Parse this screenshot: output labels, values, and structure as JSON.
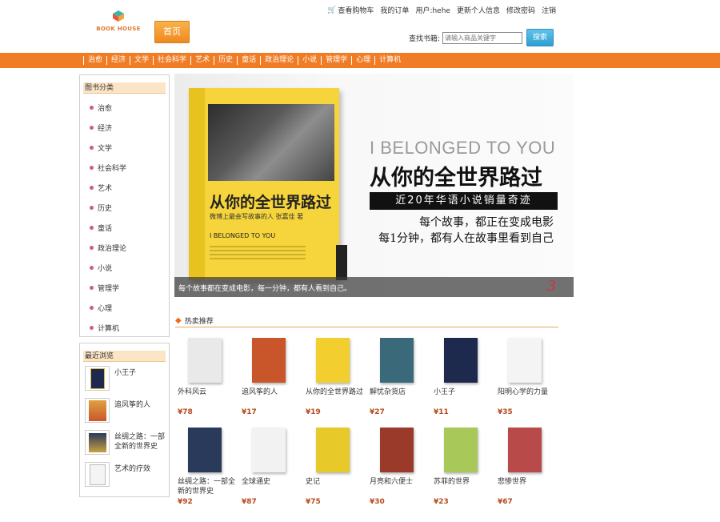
{
  "header": {
    "logo_text": "BOOK HOUSE",
    "home_label": "首页",
    "links": {
      "cart": "查看购物车",
      "orders": "我的订单",
      "user": "用户:hehe",
      "update_info": "更新个人信息",
      "change_password": "修改密码",
      "logout": "注销"
    },
    "search": {
      "label": "查找书籍:",
      "placeholder": "请输入商品关键字",
      "button": "搜索"
    }
  },
  "nav": [
    "治愈",
    "经济",
    "文学",
    "社会科学",
    "艺术",
    "历史",
    "童话",
    "政治理论",
    "小说",
    "管理学",
    "心理",
    "计算机"
  ],
  "categories": {
    "title": "图书分类",
    "items": [
      "治愈",
      "经济",
      "文学",
      "社会科学",
      "艺术",
      "历史",
      "童话",
      "政治理论",
      "小说",
      "管理学",
      "心理",
      "计算机"
    ]
  },
  "recent": {
    "title": "最近浏览",
    "items": [
      "小王子",
      "追风筝的人",
      "丝绸之路：一部全新的世界史",
      "艺术的疗效"
    ]
  },
  "banner": {
    "book_title": "从你的全世界路过",
    "book_sub": "微博上最会写故事的人 张嘉佳 著",
    "book_en": "I BELONGED TO YOU",
    "en_title": "I BELONGED TO YOU",
    "cn_title": "从你的全世界路过",
    "tagline": "近20年华语小说销量奇迹",
    "line1": "每个故事，都正在变成电影",
    "line2": "每1分钟，都有人在故事里看到自己",
    "caption": "每个故事都在变成电影，每一分钟，都有人看到自己。",
    "slide_number": "3"
  },
  "hot": {
    "title": "热卖推荐",
    "products": [
      {
        "name": "外科风云",
        "price": "¥78",
        "color": "#e9e9e9"
      },
      {
        "name": "追风筝的人",
        "price": "¥17",
        "color": "#c9562a"
      },
      {
        "name": "从你的全世界路过",
        "price": "¥19",
        "color": "#f2cf2f"
      },
      {
        "name": "解忧杂货店",
        "price": "¥27",
        "color": "#3a6a7a"
      },
      {
        "name": "小王子",
        "price": "¥11",
        "color": "#1d2a4d"
      },
      {
        "name": "阳明心学的力量",
        "price": "¥35",
        "color": "#f4f4f4"
      },
      {
        "name": "丝绸之路：一部全新的世界史",
        "price": "¥92",
        "color": "#2a3a5a"
      },
      {
        "name": "全球通史",
        "price": "¥87",
        "color": "#f2f2f2"
      },
      {
        "name": "史记",
        "price": "¥75",
        "color": "#e8c92a"
      },
      {
        "name": "月亮和六便士",
        "price": "¥30",
        "color": "#9a3a2a"
      },
      {
        "name": "苏菲的世界",
        "price": "¥23",
        "color": "#a8c85a"
      },
      {
        "name": "悲惨世界",
        "price": "¥67",
        "color": "#b84a4a"
      }
    ]
  },
  "colors": {
    "nav_bg": "#f07d26",
    "price": "#b74b1e",
    "home_button": "#ee8a1e",
    "search_button": "#2e9fd1"
  }
}
